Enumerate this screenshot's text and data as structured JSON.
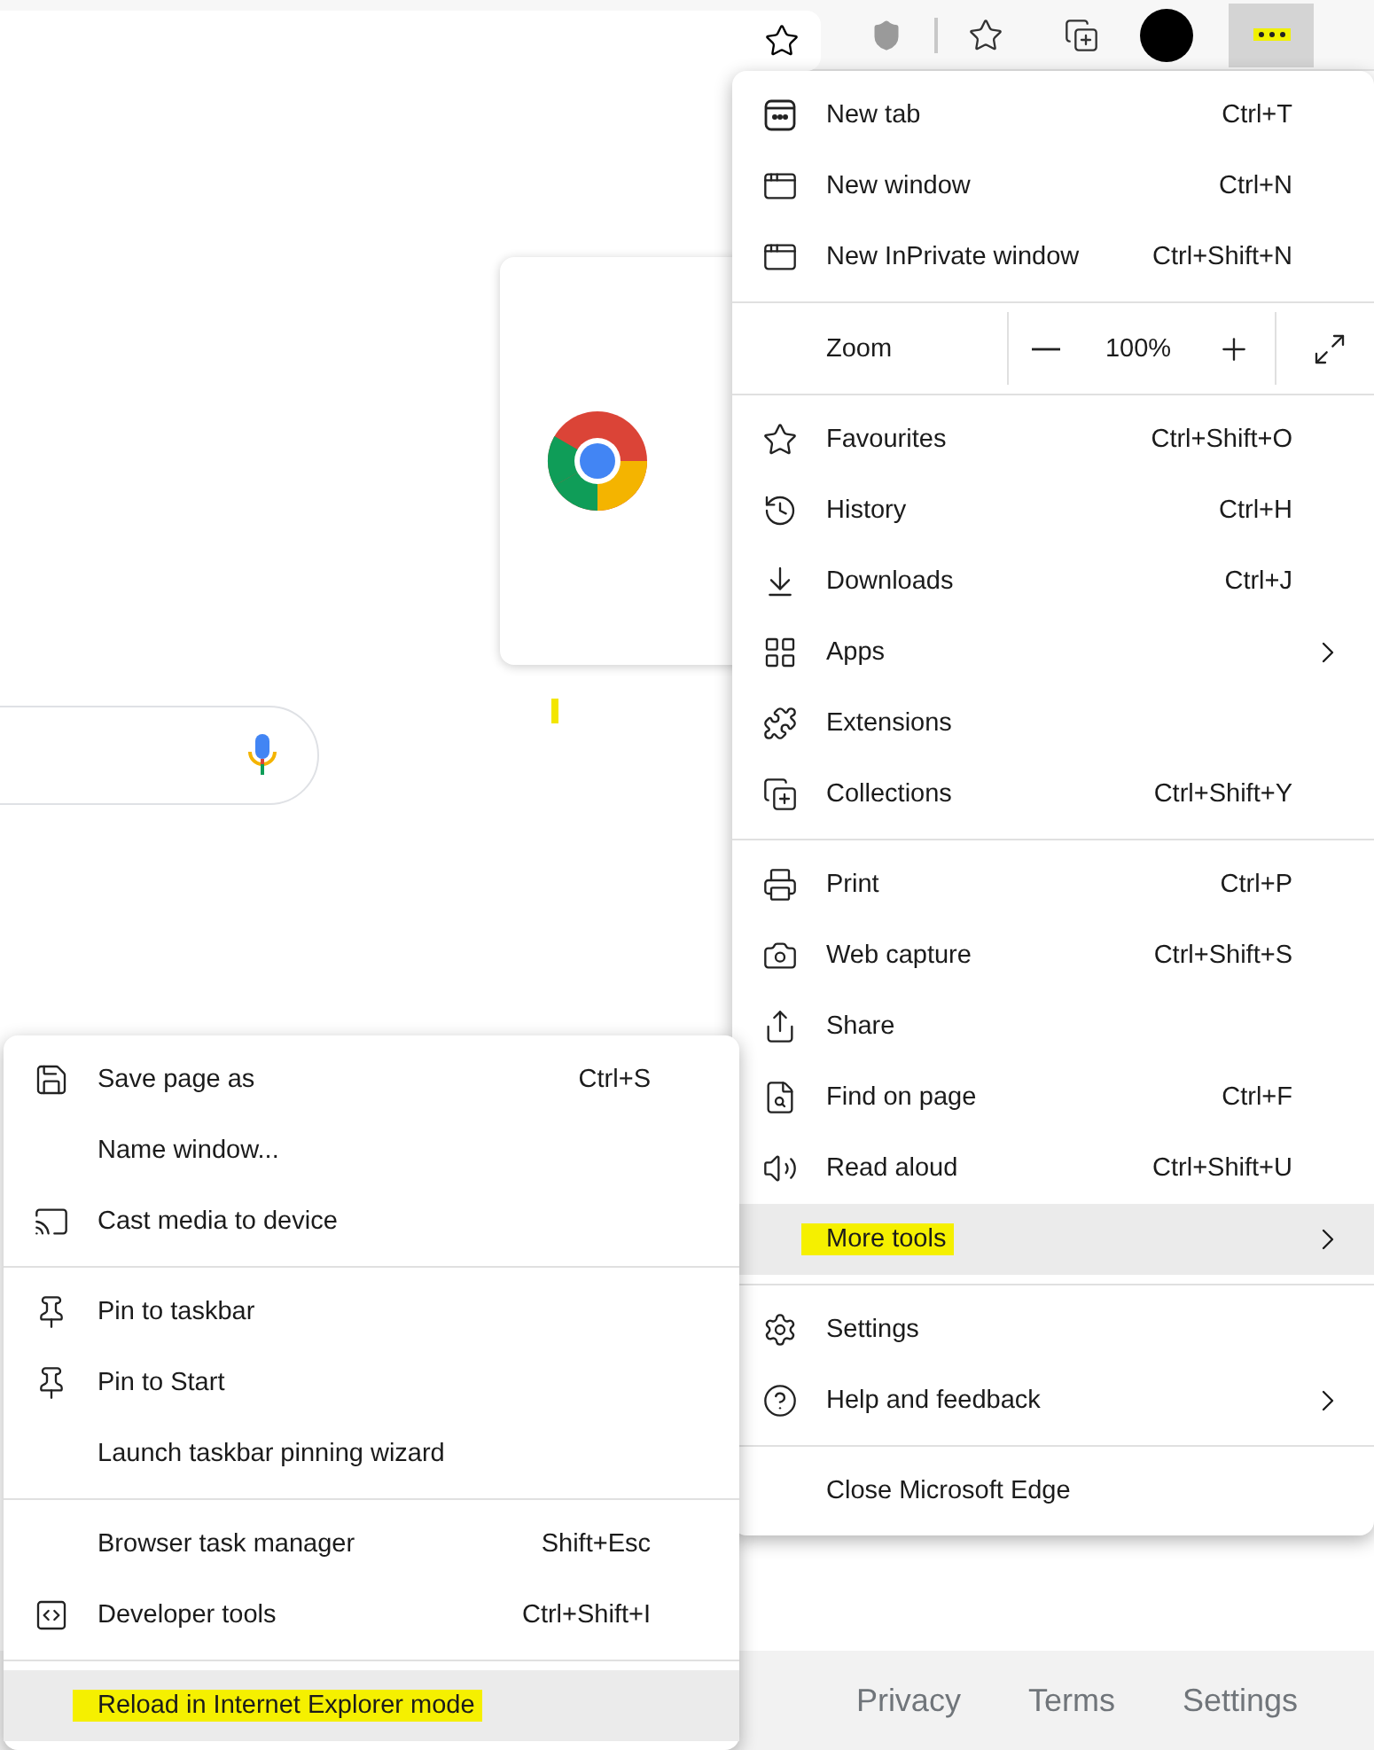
{
  "toolbar": {
    "more_button": {
      "highlighted": true
    }
  },
  "page": {
    "footer_links": [
      "Privacy",
      "Terms",
      "Settings"
    ]
  },
  "menu": {
    "sections": [
      [
        {
          "kind": "item",
          "label": "New tab",
          "shortcut": "Ctrl+T",
          "submenu": false,
          "highlighted": false
        },
        {
          "kind": "item",
          "label": "New window",
          "shortcut": "Ctrl+N",
          "submenu": false,
          "highlighted": false
        },
        {
          "kind": "item",
          "label": "New InPrivate window",
          "shortcut": "Ctrl+Shift+N",
          "submenu": false,
          "highlighted": false
        }
      ],
      [
        {
          "kind": "zoom",
          "label": "Zoom",
          "value": "100%"
        }
      ],
      [
        {
          "kind": "item",
          "label": "Favourites",
          "shortcut": "Ctrl+Shift+O",
          "submenu": false,
          "highlighted": false
        },
        {
          "kind": "item",
          "label": "History",
          "shortcut": "Ctrl+H",
          "submenu": false,
          "highlighted": false
        },
        {
          "kind": "item",
          "label": "Downloads",
          "shortcut": "Ctrl+J",
          "submenu": false,
          "highlighted": false
        },
        {
          "kind": "item",
          "label": "Apps",
          "submenu": true,
          "highlighted": false
        },
        {
          "kind": "item",
          "label": "Extensions",
          "submenu": false,
          "highlighted": false
        },
        {
          "kind": "item",
          "label": "Collections",
          "shortcut": "Ctrl+Shift+Y",
          "submenu": false,
          "highlighted": false
        }
      ],
      [
        {
          "kind": "item",
          "label": "Print",
          "shortcut": "Ctrl+P",
          "submenu": false,
          "highlighted": false
        },
        {
          "kind": "item",
          "label": "Web capture",
          "shortcut": "Ctrl+Shift+S",
          "submenu": false,
          "highlighted": false
        },
        {
          "kind": "item",
          "label": "Share",
          "submenu": false,
          "highlighted": false
        },
        {
          "kind": "item",
          "label": "Find on page",
          "shortcut": "Ctrl+F",
          "submenu": false,
          "highlighted": false
        },
        {
          "kind": "item",
          "label": "Read aloud",
          "shortcut": "Ctrl+Shift+U",
          "submenu": false,
          "highlighted": false
        },
        {
          "kind": "item",
          "label": "More tools",
          "submenu": true,
          "highlighted": true
        }
      ],
      [
        {
          "kind": "item",
          "label": "Settings",
          "submenu": false,
          "highlighted": false
        },
        {
          "kind": "item",
          "label": "Help and feedback",
          "submenu": true,
          "highlighted": false
        }
      ],
      [
        {
          "kind": "item",
          "label": "Close Microsoft Edge",
          "submenu": false,
          "highlighted": false
        }
      ]
    ]
  },
  "submenu": {
    "sections": [
      [
        {
          "label": "Save page as",
          "shortcut": "Ctrl+S",
          "highlighted": false
        },
        {
          "label": "Name window...",
          "highlighted": false
        },
        {
          "label": "Cast media to device",
          "highlighted": false
        }
      ],
      [
        {
          "label": "Pin to taskbar",
          "highlighted": false
        },
        {
          "label": "Pin to Start",
          "highlighted": false
        },
        {
          "label": "Launch taskbar pinning wizard",
          "highlighted": false
        }
      ],
      [
        {
          "label": "Browser task manager",
          "shortcut": "Shift+Esc",
          "highlighted": false
        },
        {
          "label": "Developer tools",
          "shortcut": "Ctrl+Shift+I",
          "highlighted": false
        }
      ],
      [
        {
          "label": "Reload in Internet Explorer mode",
          "highlighted": true
        }
      ]
    ]
  }
}
